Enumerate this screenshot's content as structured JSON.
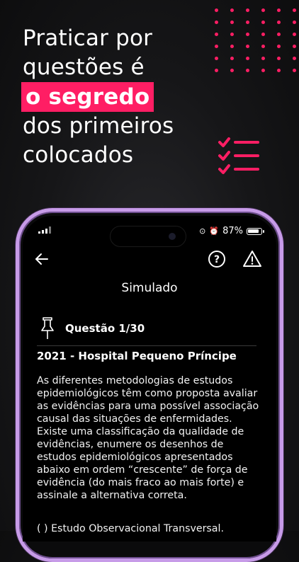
{
  "headline": {
    "line1": "Praticar por",
    "line2": "questões é",
    "highlight": "o segredo",
    "line4": "dos primeiros",
    "line5": "colocados"
  },
  "colors": {
    "accent": "#ff1e64",
    "frame": "#c79be8"
  },
  "status_bar": {
    "battery": "87%"
  },
  "app": {
    "title": "Simulado",
    "question_label": "Questão 1/30",
    "source": "2021 - Hospital Pequeno Príncipe",
    "body": "As diferentes metodologias de estudos epidemiológicos têm como proposta avaliar as evidências para uma possível associação causal das situações de enfermidades. Existe uma classificação da qualidade de evidências, enumere os desenhos de estudos epidemiológicos apresentados abaixo em ordem “crescente” de força de evidência (do mais fraco ao mais forte) e assinale a alternativa correta.",
    "option1": "( ) Estudo Observacional Transversal."
  },
  "icons": [
    "arrow-left-icon",
    "question-circle-icon",
    "warning-triangle-icon",
    "pin-icon",
    "checklist-icon"
  ]
}
